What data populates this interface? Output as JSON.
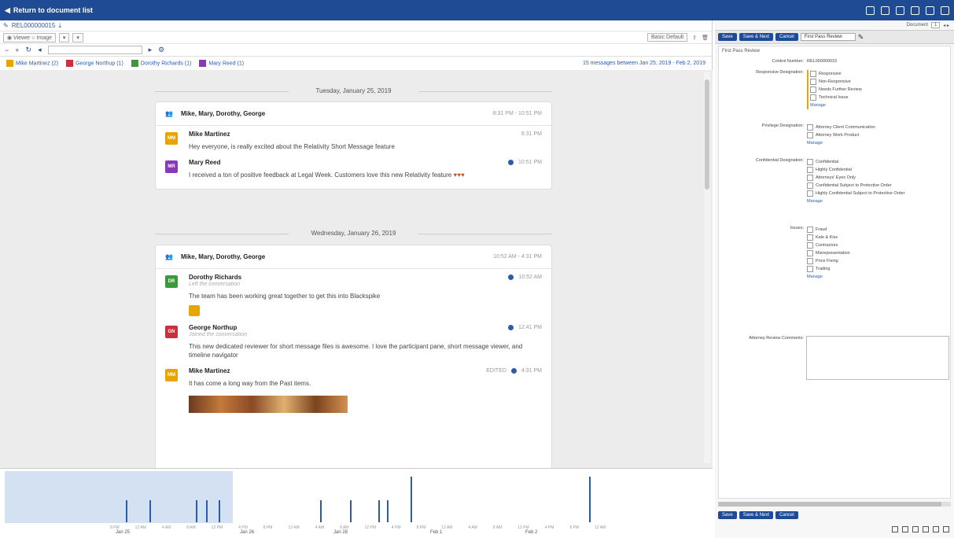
{
  "topbar": {
    "back_label": "Return to document list"
  },
  "doc": {
    "control_number": "REL000000015"
  },
  "toolbar": {
    "layout_label": "Basic Default"
  },
  "participants": [
    {
      "name": "Mike Martinez (2)",
      "color": "#e8a500"
    },
    {
      "name": "George Northup (1)",
      "color": "#c8323c"
    },
    {
      "name": "Dorothy Richards (1)",
      "color": "#3a9a3a"
    },
    {
      "name": "Mary Reed (1)",
      "color": "#8a3ab9"
    }
  ],
  "summary": "15 messages between Jan 25, 2019 - Feb 2, 2019",
  "day1": {
    "date": "Tuesday, January 25, 2019",
    "participants": "Mike, Mary, Dorothy, George",
    "time": "8:31 PM - 10:51 PM",
    "messages": [
      {
        "name": "Mike Martinez",
        "initials": "MM",
        "time": "8:31 PM",
        "text": "Hey everyone, is really excited about the Relativity Short Message feature"
      },
      {
        "name": "Mary Reed",
        "initials": "MR",
        "time": "10:51 PM",
        "text": "I received a ton of positive feedback at Legal Week. Customers love this new Relativity feature"
      }
    ]
  },
  "day2": {
    "date": "Wednesday, January 26, 2019",
    "participants": "Mike, Mary, Dorothy, George",
    "time": "10:52 AM - 4:31 PM",
    "messages": [
      {
        "name": "Dorothy Richards",
        "initials": "DR",
        "status": "Left the conversation",
        "time": "10:52 AM",
        "text": "The team has been working great together to get this into Blackspike"
      },
      {
        "name": "George Northup",
        "initials": "GN",
        "status": "Joined the conversation",
        "time": "12:41 PM",
        "text": "This new dedicated reviewer for short message files is awesome. I love the participant pane, short message viewer, and timeline navigator"
      },
      {
        "name": "Mike Martinez",
        "initials": "MM",
        "tag": "EDITED",
        "time": "4:31 PM",
        "text": "It has come a long way from the Past items."
      }
    ]
  },
  "timeline": {
    "labels": [
      "Jan 25",
      "Jan 26",
      "Jan 28",
      "Feb 1",
      "Feb 2"
    ],
    "tick_labels": [
      "8 PM",
      "12 AM",
      "4 AM",
      "8 AM",
      "12 PM",
      "4 PM",
      "8 PM",
      "12 AM",
      "4 AM",
      "8 AM",
      "12 PM",
      "4 PM",
      "8 PM",
      "12 AM",
      "4 AM",
      "8 AM",
      "12 PM",
      "4 PM",
      "8 PM",
      "12 AM"
    ]
  },
  "panel": {
    "document_label": "Document",
    "buttons": {
      "save": "Save",
      "save_next": "Save & Next",
      "cancel": "Cancel"
    },
    "layout": "First Pass Review",
    "form_title": "First Pass Review",
    "control_label": "Control Number:",
    "control_value": "REL000000015",
    "responsive_label": "Responsive Designation:",
    "responsive_opts": [
      "Responsive",
      "Non-Responsive",
      "Needs Further Review",
      "Technical Issue"
    ],
    "privilege_label": "Privilege Designation:",
    "privilege_opts": [
      "Attorney Client Communication",
      "Attorney Work Product"
    ],
    "confidential_label": "Confidential Designation:",
    "confidential_opts": [
      "Confidential",
      "Highly Confidential",
      "Attorneys' Eyes Only",
      "Confidential Subject to Protective Order",
      "Highly Confidential Subject to Protective Order"
    ],
    "issues_label": "Issues:",
    "issues_opts": [
      "Fraud",
      "Kale & Kiss",
      "Contractors",
      "Misrepresentation",
      "Price Fixing",
      "Trading"
    ],
    "manage": "Manage",
    "comments_label": "Attorney Review Comments:"
  }
}
